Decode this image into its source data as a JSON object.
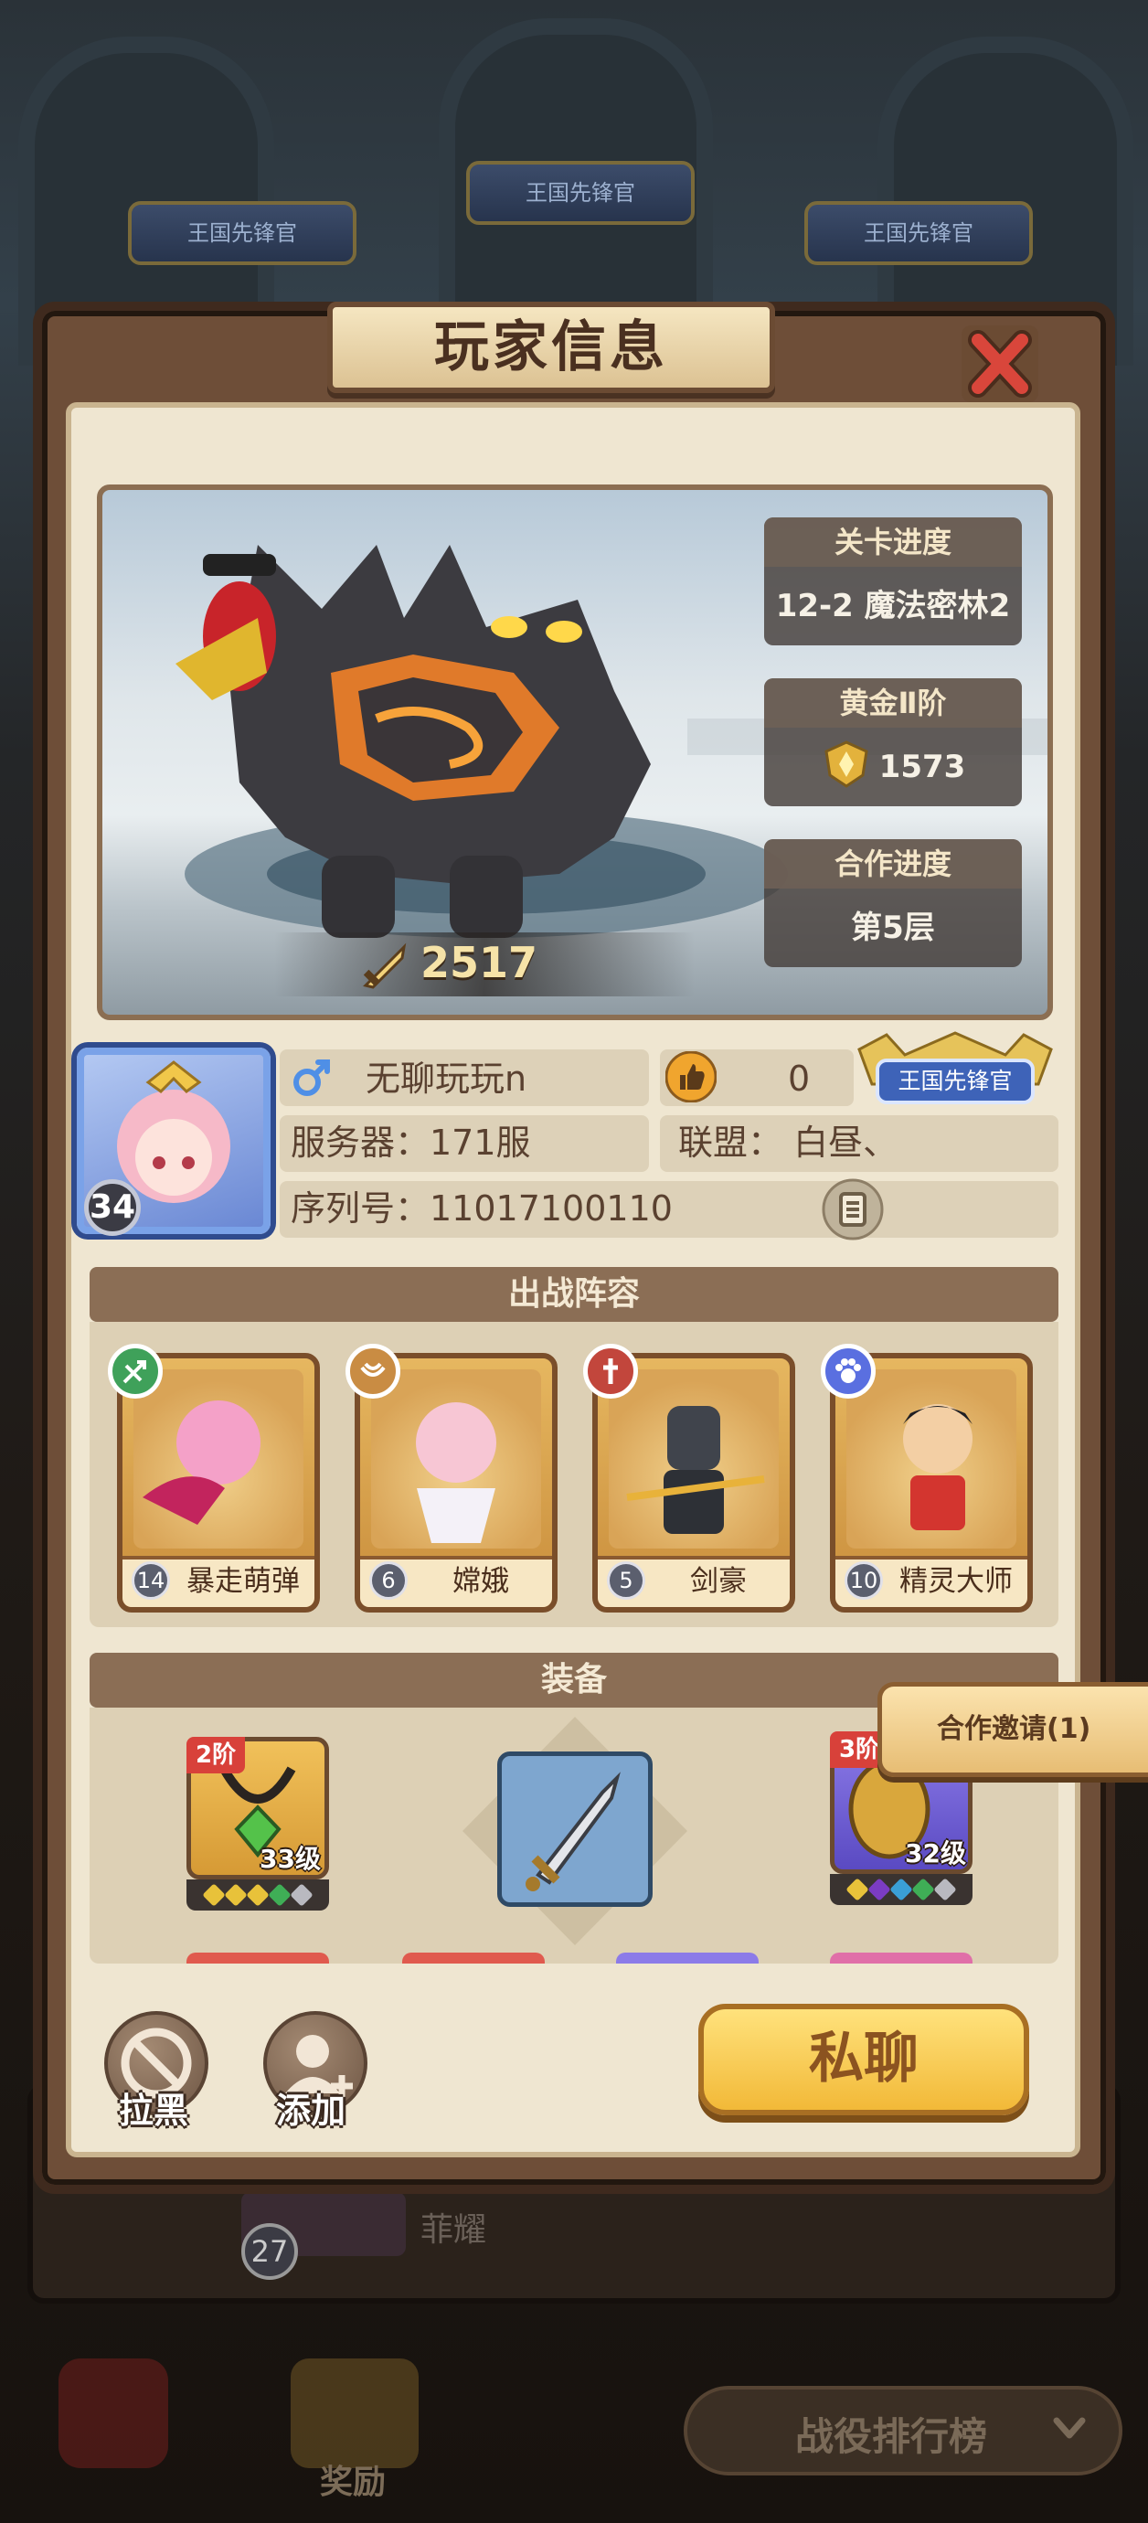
{
  "background": {
    "rank_badges": [
      "王国先锋官",
      "王国先锋官",
      "王国先锋官"
    ],
    "row_level": "27",
    "row_name": "菲耀",
    "reward_label": "奖励",
    "leaderboard_label": "战役排行榜"
  },
  "dialog": {
    "title": "玩家信息"
  },
  "showcase": {
    "power": "2517",
    "stats": [
      {
        "label": "关卡进度",
        "value": "12-2 魔法密林2"
      },
      {
        "label": "黄金Ⅱ阶",
        "value": "1573"
      },
      {
        "label": "合作进度",
        "value": "第5层"
      }
    ]
  },
  "player": {
    "level": "34",
    "name": "无聊玩玩n",
    "likes": "0",
    "title_badge": "王国先锋官",
    "server": "服务器：171服",
    "alliance": "联盟：  白昼、",
    "serial": "序列号：11017100110"
  },
  "lineup": {
    "header": "出战阵容",
    "heroes": [
      {
        "level": "14",
        "name": "暴走萌弹",
        "role_icon": "archer-icon",
        "role_color": "#3fa15a"
      },
      {
        "level": "6",
        "name": "嫦娥",
        "role_icon": "support-icon",
        "role_color": "#c98c43"
      },
      {
        "level": "5",
        "name": "剑豪",
        "role_icon": "warrior-icon",
        "role_color": "#c2463c"
      },
      {
        "level": "10",
        "name": "精灵大师",
        "role_icon": "paw-icon",
        "role_color": "#5a6fe0"
      }
    ]
  },
  "equipment": {
    "header": "装备",
    "items": [
      {
        "tier": "2阶",
        "level": "33级",
        "kind": "amulet-icon",
        "gems": [
          "#e8c23a",
          "#e8c23a",
          "#e8c23a",
          "#3fae56",
          "#b9b9c0"
        ]
      },
      {
        "tier": "3阶",
        "level": "32级",
        "kind": "shield-icon",
        "gems": [
          "#e8c23a",
          "#7b3cc2",
          "#3a9fd6",
          "#3fae56",
          "#b9b9c0"
        ]
      }
    ]
  },
  "coop_invite": "合作邀请(1)",
  "actions": {
    "block": "拉黑",
    "add": "添加",
    "chat": "私聊"
  },
  "colors": {
    "panel": "#6e4e38",
    "panel_inner": "#efe6d1",
    "accent_gold": "#f2b938",
    "close_red": "#d9463b"
  }
}
